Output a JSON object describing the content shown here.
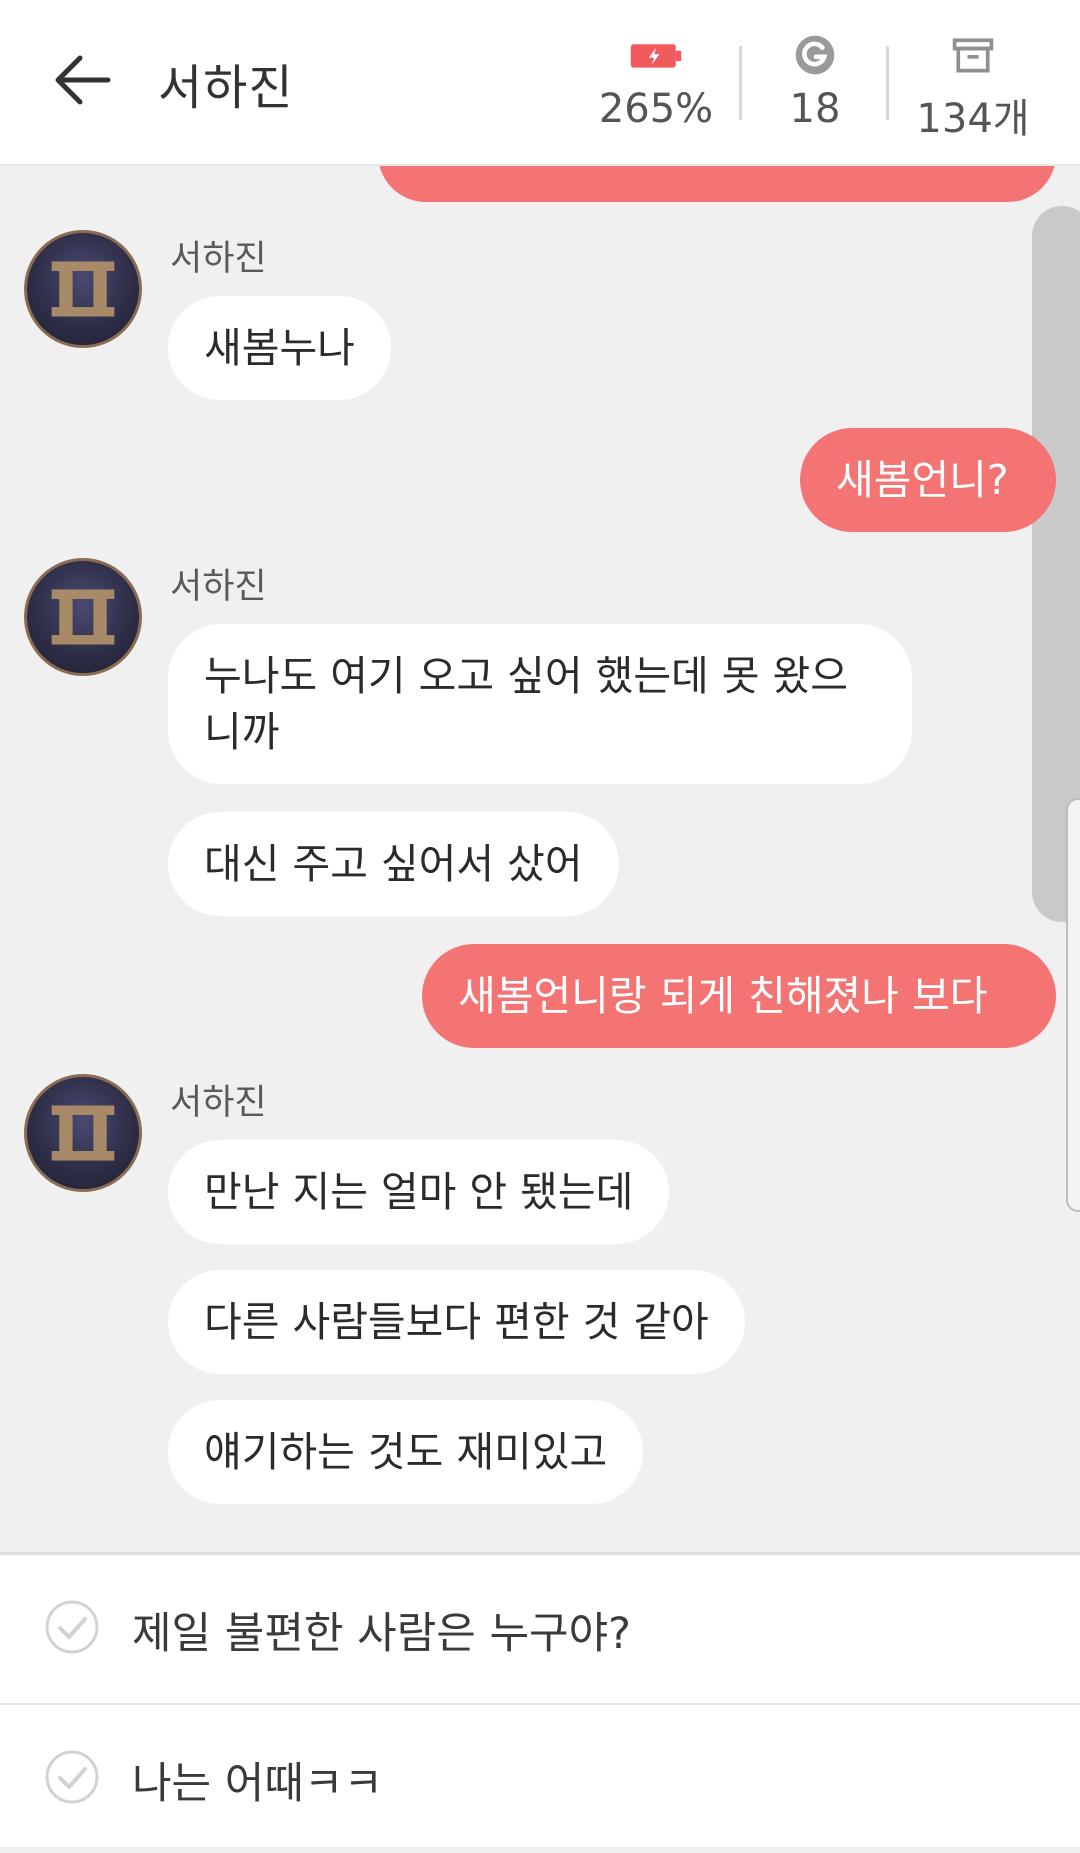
{
  "header": {
    "title": "서하진",
    "energy": "265%",
    "gems": "18",
    "items": "134개"
  },
  "colors": {
    "accent": "#f47474",
    "background": "#f0f0f0"
  },
  "avatar_icon": "monogram-avatar",
  "messages": [
    {
      "sender": "서하진",
      "texts": [
        "새봄누나"
      ]
    },
    {
      "mine": "새봄언니?"
    },
    {
      "sender": "서하진",
      "texts": [
        "누나도 여기 오고 싶어 했는데 못 왔으니까",
        "대신 주고 싶어서 샀어"
      ]
    },
    {
      "mine": "새봄언니랑 되게 친해졌나 보다"
    },
    {
      "sender": "서하진",
      "texts": [
        "만난 지는 얼마 안 됐는데",
        "다른 사람들보다 편한 것 같아",
        "얘기하는 것도 재미있고"
      ]
    }
  ],
  "replies": [
    {
      "text": "제일 불편한 사람은 누구야?"
    },
    {
      "text": "나는 어때ㅋㅋ"
    }
  ]
}
